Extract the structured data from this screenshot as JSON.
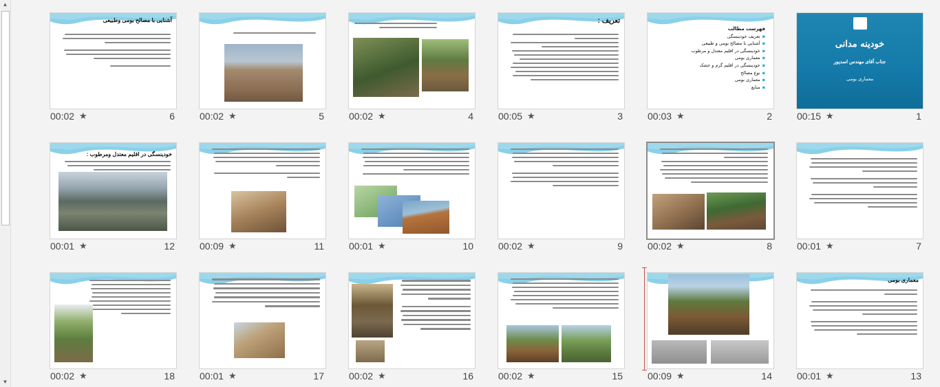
{
  "slides": [
    {
      "num": "1",
      "time": "00:15",
      "title": "خودینه مدانی",
      "subtitle": "جناب آقای مهندس اسدپور",
      "extra": "معماری بومی"
    },
    {
      "num": "2",
      "time": "00:03",
      "title": "فهرست مطالب",
      "toc": [
        "تعریف خودینسگی",
        "آشنایی با مصالح بومی و طبیعی",
        "خودینسگی در اقلیم معتدل و مرطوب",
        "معماری بومی",
        "خودینسگی در اقلیم گرم و خشک",
        "نوع مصالح",
        "معماری بومی",
        "منابع"
      ]
    },
    {
      "num": "3",
      "time": "00:05",
      "title": "تعریف :"
    },
    {
      "num": "4",
      "time": "00:02",
      "title": ""
    },
    {
      "num": "5",
      "time": "00:02",
      "title": ""
    },
    {
      "num": "6",
      "time": "00:02",
      "title": "آشنایی با مصالح بومی وطبیعی"
    },
    {
      "num": "7",
      "time": "00:01",
      "title": ""
    },
    {
      "num": "8",
      "time": "00:02",
      "title": ""
    },
    {
      "num": "9",
      "time": "00:02",
      "title": ""
    },
    {
      "num": "10",
      "time": "00:01",
      "title": ""
    },
    {
      "num": "11",
      "time": "00:09",
      "title": ""
    },
    {
      "num": "12",
      "time": "00:01",
      "title": "خودینسگی در اقلیم معتدل ومرطوب :"
    },
    {
      "num": "13",
      "time": "00:01",
      "title": "معماری بومی"
    },
    {
      "num": "14",
      "time": "00:09",
      "title": ""
    },
    {
      "num": "15",
      "time": "00:02",
      "title": ""
    },
    {
      "num": "16",
      "time": "00:02",
      "title": ""
    },
    {
      "num": "17",
      "time": "00:01",
      "title": ""
    },
    {
      "num": "18",
      "time": "00:02",
      "title": ""
    }
  ],
  "colors": {
    "accent": "#2aa9d6",
    "titleSlide": "#147aa9",
    "insertionMarker": "#c0504d"
  },
  "icons": {
    "star": "star-icon",
    "scrollUp": "arrow-up-icon",
    "scrollDown": "arrow-down-icon"
  }
}
